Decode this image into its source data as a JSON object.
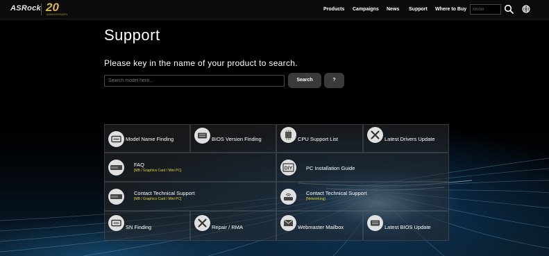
{
  "header": {
    "logo": "ASRock",
    "anniversary": "20",
    "anniversary_sub": "ANNIVERSARY",
    "nav": [
      "Products",
      "Campaigns",
      "News",
      "Support",
      "Where to Buy"
    ],
    "model_placeholder": "Model",
    "icons": [
      "search-icon",
      "globe-icon"
    ]
  },
  "main": {
    "title": "Support",
    "prompt": "Please key in the name of your product to search.",
    "search_placeholder": "Search model here...",
    "search_button": "Search",
    "help_button": "?"
  },
  "tiles": [
    {
      "title": "Model Name Finding",
      "icon": "label-icon"
    },
    {
      "title": "BIOS Version Finding",
      "icon": "chip-icon"
    },
    {
      "title": "CPU Support List",
      "icon": "cpu-icon"
    },
    {
      "title": "Latest Drivers Update",
      "icon": "tools-icon"
    },
    {
      "title": "FAQ",
      "subtitle": "[MB / Graphics Card / Mini PC]",
      "icon": "graphics-card-icon"
    },
    {
      "title": "PC Installation Guide",
      "icon": "diy-icon"
    },
    {
      "title": "Contact Technical Support",
      "subtitle": "[MB / Graphics Card / Mini PC]",
      "icon": "graphics-card-icon"
    },
    {
      "title": "Contact Technical Support",
      "subtitle": "[Networking]",
      "icon": "router-icon"
    },
    {
      "title": "SN Finding",
      "icon": "sn-label-icon"
    },
    {
      "title": "Repair / RMA",
      "icon": "tools-icon"
    },
    {
      "title": "Webmaster Mailbox",
      "icon": "mail-icon"
    },
    {
      "title": "Latest BIOS Update",
      "icon": "chip-icon"
    }
  ],
  "colors": {
    "accent_yellow": "#e7d23a",
    "background": "#000000",
    "button_bg": "#3a3a3a",
    "gold": "#d9b45a"
  }
}
